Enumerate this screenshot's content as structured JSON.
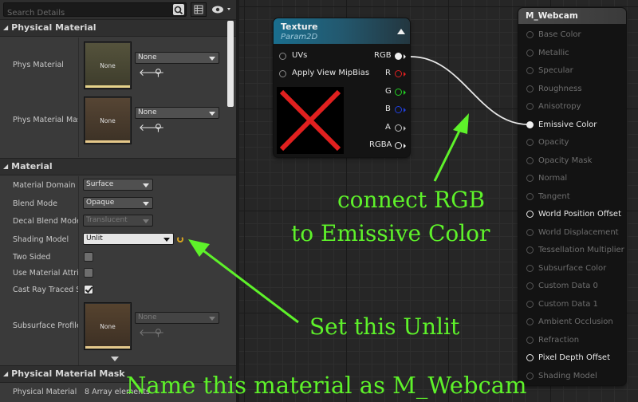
{
  "details": {
    "search": {
      "placeholder": "Search Details"
    },
    "categories": {
      "physical_material": "Physical Material",
      "material": "Material",
      "physical_material_mask": "Physical Material Mask"
    },
    "physical_material": {
      "phys_material": {
        "label": "Phys Material",
        "thumb_text": "None",
        "value": "None"
      },
      "phys_material_mask": {
        "label": "Phys Material Mask",
        "thumb_text": "None",
        "value": "None"
      }
    },
    "material": {
      "material_domain": {
        "label": "Material Domain",
        "value": "Surface"
      },
      "blend_mode": {
        "label": "Blend Mode",
        "value": "Opaque"
      },
      "decal_blend_mode": {
        "label": "Decal Blend Mode",
        "value": "Translucent"
      },
      "shading_model": {
        "label": "Shading Model",
        "value": "Unlit"
      },
      "two_sided": {
        "label": "Two Sided",
        "checked": false
      },
      "use_material_attributes": {
        "label": "Use Material Attributes",
        "checked": false
      },
      "cast_ray_traced_shadows": {
        "label": "Cast Ray Traced Shadows",
        "checked": true
      },
      "subsurface_profile": {
        "label": "Subsurface Profile",
        "thumb_text": "None",
        "value": "None"
      }
    },
    "physical_material_mask": {
      "label": "Physical Material Map",
      "value": "8 Array elements"
    }
  },
  "graph": {
    "texture_node": {
      "title": "Texture",
      "subtitle": "Param2D",
      "inputs": [
        "UVs",
        "Apply View MipBias"
      ],
      "outputs": [
        "RGB",
        "R",
        "G",
        "B",
        "A",
        "RGBA"
      ],
      "output_colors": [
        "#f0f0f0",
        "#e02020",
        "#22d022",
        "#2040e0",
        "#bdbdbd",
        "#f0f0f0"
      ]
    },
    "material_node": {
      "title": "M_Webcam",
      "inputs": [
        {
          "label": "Base Color",
          "active": false
        },
        {
          "label": "Metallic",
          "active": false
        },
        {
          "label": "Specular",
          "active": false
        },
        {
          "label": "Roughness",
          "active": false
        },
        {
          "label": "Anisotropy",
          "active": false
        },
        {
          "label": "Emissive Color",
          "active": true,
          "connected": true
        },
        {
          "label": "Opacity",
          "active": false
        },
        {
          "label": "Opacity Mask",
          "active": false
        },
        {
          "label": "Normal",
          "active": false
        },
        {
          "label": "Tangent",
          "active": false
        },
        {
          "label": "World Position Offset",
          "active": true
        },
        {
          "label": "World Displacement",
          "active": false
        },
        {
          "label": "Tessellation Multiplier",
          "active": false
        },
        {
          "label": "Subsurface Color",
          "active": false
        },
        {
          "label": "Custom Data 0",
          "active": false
        },
        {
          "label": "Custom Data 1",
          "active": false
        },
        {
          "label": "Ambient Occlusion",
          "active": false
        },
        {
          "label": "Refraction",
          "active": false
        },
        {
          "label": "Pixel Depth Offset",
          "active": true
        },
        {
          "label": "Shading Model",
          "active": false
        }
      ]
    }
  },
  "annotations": {
    "connect_line1": "connect RGB",
    "connect_line2": "to Emissive Color",
    "set_unlit": "Set this Unlit",
    "name_material": "Name this material as M_Webcam",
    "color": "#5ef22a"
  }
}
